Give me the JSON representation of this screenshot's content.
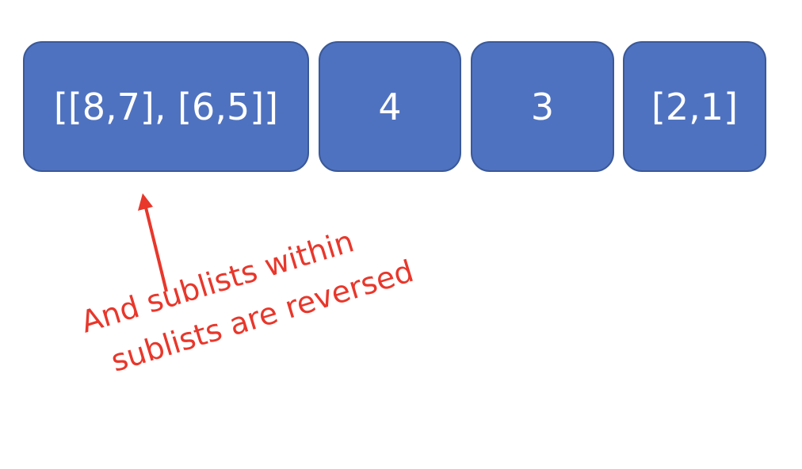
{
  "boxes": [
    {
      "label": "[[8,7], [6,5]]"
    },
    {
      "label": "4"
    },
    {
      "label": "3"
    },
    {
      "label": "[2,1]"
    }
  ],
  "annotation": {
    "line1": "And sublists within",
    "line2": "sublists are reversed",
    "color": "#e8372b"
  },
  "colors": {
    "box_fill": "#4f72c0",
    "box_border": "#3a5999",
    "box_text": "#ffffff"
  }
}
